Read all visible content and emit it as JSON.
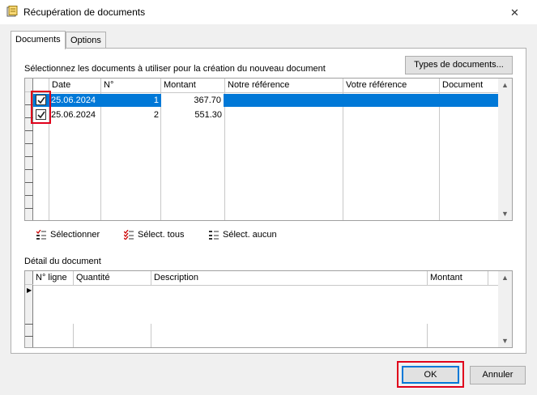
{
  "window": {
    "title": "Récupération de documents",
    "close_glyph": "✕"
  },
  "tabs": [
    {
      "label": "Documents",
      "active": true
    },
    {
      "label": "Options",
      "active": false
    }
  ],
  "documents": {
    "instruction": "Sélectionnez les documents à utiliser pour la création du nouveau document",
    "types_button": "Types de documents...",
    "columns": [
      "Date",
      "N°",
      "Montant",
      "Notre référence",
      "Votre référence",
      "Document"
    ],
    "rows": [
      {
        "checked": true,
        "selected": true,
        "date": "25.06.2024",
        "num": "1",
        "montant": "367.70",
        "notre_ref": "",
        "votre_ref": "",
        "document": ""
      },
      {
        "checked": true,
        "selected": false,
        "date": "25.06.2024",
        "num": "2",
        "montant": "551.30",
        "notre_ref": "",
        "votre_ref": "",
        "document": ""
      }
    ]
  },
  "toolbar": {
    "select_label": "Sélectionner",
    "select_all_label": "Sélect. tous",
    "select_none_label": "Sélect. aucun"
  },
  "detail": {
    "label": "Détail du document",
    "columns": [
      "N° ligne",
      "Quantité",
      "Description",
      "Montant"
    ]
  },
  "footer": {
    "ok_label": "OK",
    "cancel_label": "Annuler"
  },
  "colors": {
    "selection": "#0078d7",
    "highlight_box": "#e0001b",
    "window_bg": "#f0f0f0"
  }
}
